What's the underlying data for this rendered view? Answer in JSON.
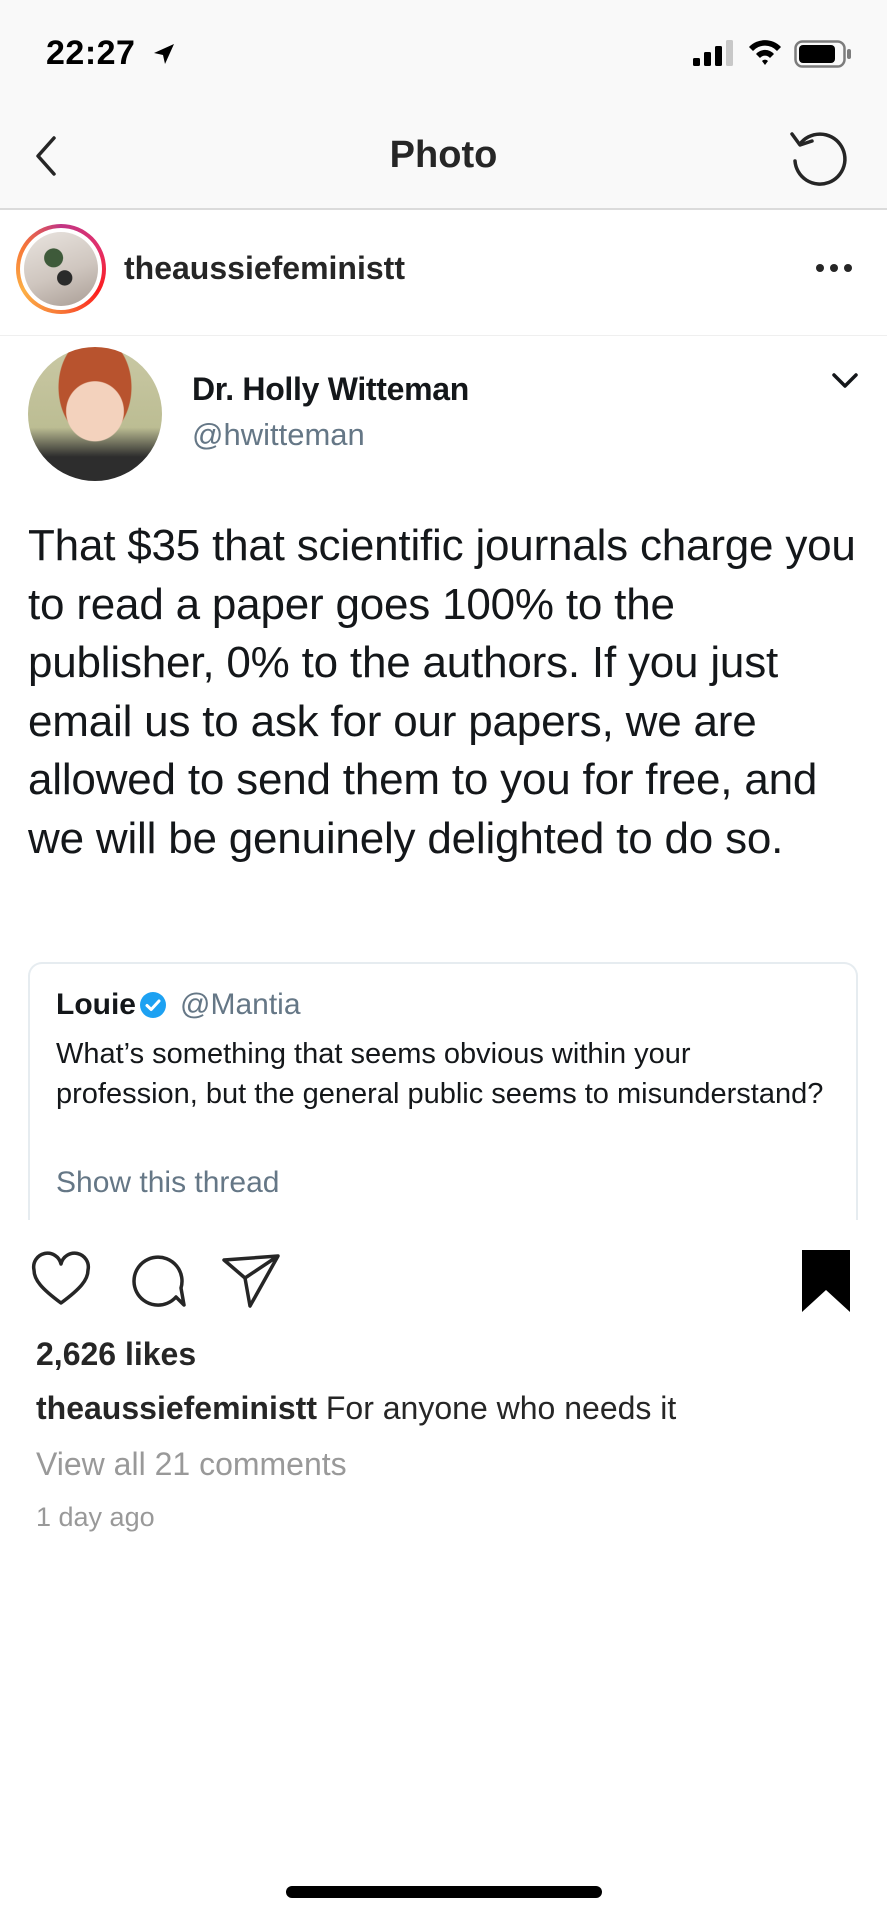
{
  "status_bar": {
    "time": "22:27"
  },
  "nav": {
    "title": "Photo"
  },
  "post": {
    "username": "theaussiefeministt"
  },
  "tweet": {
    "author_name": "Dr. Holly Witteman",
    "author_handle": "@hwitteman",
    "text": "That $35 that scientific journals charge you to read a paper goes 100% to the publisher, 0% to the authors. If you just email us to ask for our papers, we are allowed to send them to you for free, and we will be genuinely delighted to do so.",
    "quote": {
      "name": "Louie",
      "handle": "@Mantia",
      "text": "What’s something that seems obvious within your profession, but the general public seems to misunderstand?",
      "show_thread": "Show this thread"
    }
  },
  "engagement": {
    "likes": "2,626 likes",
    "caption_username": "theaussiefeministt",
    "caption_text": "For anyone who needs it",
    "view_comments": "View all 21 comments",
    "time_ago": "1 day ago"
  },
  "icons": {
    "back": "chevron-left-icon",
    "refresh": "refresh-icon",
    "more": "more-horizontal-icon",
    "like": "heart-icon",
    "comment": "comment-icon",
    "share": "send-icon",
    "save": "bookmark-icon",
    "verified": "verified-badge-icon"
  },
  "colors": {
    "verified": "#1da1f2",
    "secondary_text": "#999999",
    "tweet_handle": "#657786"
  }
}
